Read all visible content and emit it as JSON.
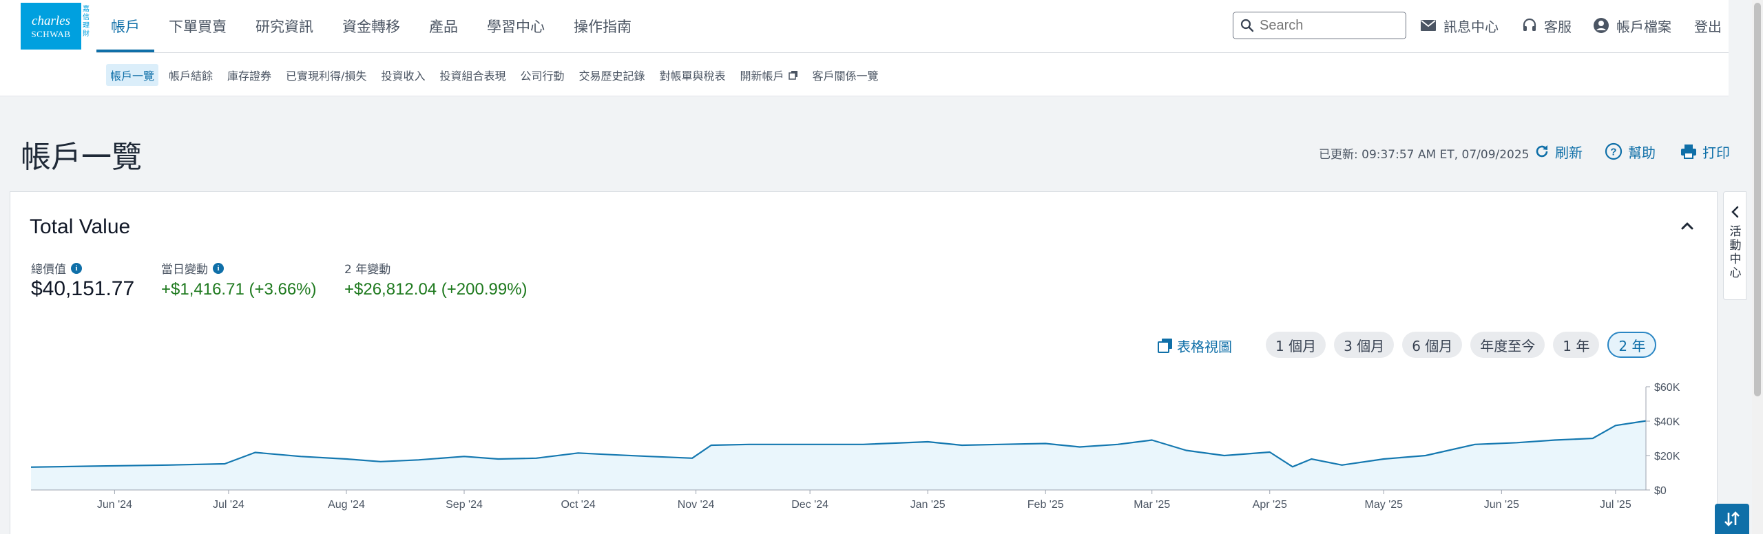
{
  "logo": {
    "line1": "charles",
    "line2": "SCHWAB",
    "side": "嘉信理財"
  },
  "nav": [
    "帳戶",
    "下單買賣",
    "研究資訊",
    "資金轉移",
    "產品",
    "學習中心",
    "操作指南"
  ],
  "search": {
    "placeholder": "Search"
  },
  "utility": {
    "messages": "訊息中心",
    "support": "客服",
    "profile": "帳戶檔案",
    "logout": "登出"
  },
  "subnav": [
    "帳戶一覽",
    "帳戶結餘",
    "庫存證券",
    "已實現利得/損失",
    "投資收入",
    "投資組合表現",
    "公司行動",
    "交易歷史記錄",
    "對帳單與稅表",
    "開新帳戶",
    "客戶關係一覽"
  ],
  "page": {
    "title": "帳戶一覽",
    "updated": "已更新: 09:37:57 AM ET, 07/09/2025",
    "refresh": "刷新",
    "help": "幫助",
    "print": "打印"
  },
  "card": {
    "title": "Total Value",
    "total_label": "總價值",
    "total_value": "$40,151.77",
    "day_label": "當日變動",
    "day_value": "+$1,416.71 (+3.66%)",
    "period_label": "2 年變動",
    "period_value": "+$26,812.04 (+200.99%)",
    "table_view": "表格視圖",
    "ranges": [
      "1 個月",
      "3 個月",
      "6 個月",
      "年度至今",
      "1 年",
      "2 年"
    ],
    "active_range": 5
  },
  "activity_center": "活動中心",
  "colors": {
    "accent": "#0f6fa8",
    "positive": "#1f7a1f",
    "chart_line": "#1478b0",
    "chart_fill": "#eaf6fc"
  },
  "chart_data": {
    "type": "area",
    "x": [
      "2024-05-10",
      "2024-05-25",
      "2024-06-15",
      "2024-06-30",
      "2024-07-08",
      "2024-07-20",
      "2024-08-01",
      "2024-08-10",
      "2024-08-20",
      "2024-09-01",
      "2024-09-10",
      "2024-09-20",
      "2024-10-01",
      "2024-10-10",
      "2024-10-20",
      "2024-10-31",
      "2024-11-05",
      "2024-11-15",
      "2024-12-01",
      "2024-12-15",
      "2025-01-01",
      "2025-01-10",
      "2025-01-20",
      "2025-02-01",
      "2025-02-10",
      "2025-02-20",
      "2025-03-01",
      "2025-03-10",
      "2025-03-20",
      "2025-04-01",
      "2025-04-07",
      "2025-04-12",
      "2025-04-20",
      "2025-05-01",
      "2025-05-12",
      "2025-05-25",
      "2025-06-05",
      "2025-06-15",
      "2025-06-25",
      "2025-07-01",
      "2025-07-09"
    ],
    "values": [
      13300,
      13800,
      14500,
      15200,
      21800,
      19500,
      18000,
      16500,
      17500,
      19500,
      18000,
      18500,
      21500,
      20500,
      19500,
      18500,
      26000,
      26500,
      26500,
      26500,
      28000,
      26000,
      26500,
      27000,
      25000,
      26500,
      29000,
      23000,
      20000,
      22000,
      13500,
      18000,
      14500,
      18000,
      20000,
      26500,
      27500,
      29000,
      30000,
      37500,
      40151.77
    ],
    "xlabel": "",
    "ylabel": "",
    "x_tick_labels": [
      "Jun '24",
      "Jul '24",
      "Aug '24",
      "Sep '24",
      "Oct '24",
      "Nov '24",
      "Dec '24",
      "Jan '25",
      "Feb '25",
      "Mar '25",
      "Apr '25",
      "May '25",
      "Jun '25",
      "Jul '25"
    ],
    "x_ticks": [
      "2024-06-01",
      "2024-07-01",
      "2024-08-01",
      "2024-09-01",
      "2024-10-01",
      "2024-11-01",
      "2024-12-01",
      "2025-01-01",
      "2025-02-01",
      "2025-03-01",
      "2025-04-01",
      "2025-05-01",
      "2025-06-01",
      "2025-07-01"
    ],
    "x_range": [
      "2024-05-10",
      "2025-07-09"
    ],
    "y_ticks": [
      0,
      20000,
      40000,
      60000
    ],
    "y_tick_labels": [
      "$0",
      "$20K",
      "$40K",
      "$60K"
    ],
    "ylim": [
      0,
      60000
    ],
    "grid": false,
    "y_axis_side": "right"
  }
}
